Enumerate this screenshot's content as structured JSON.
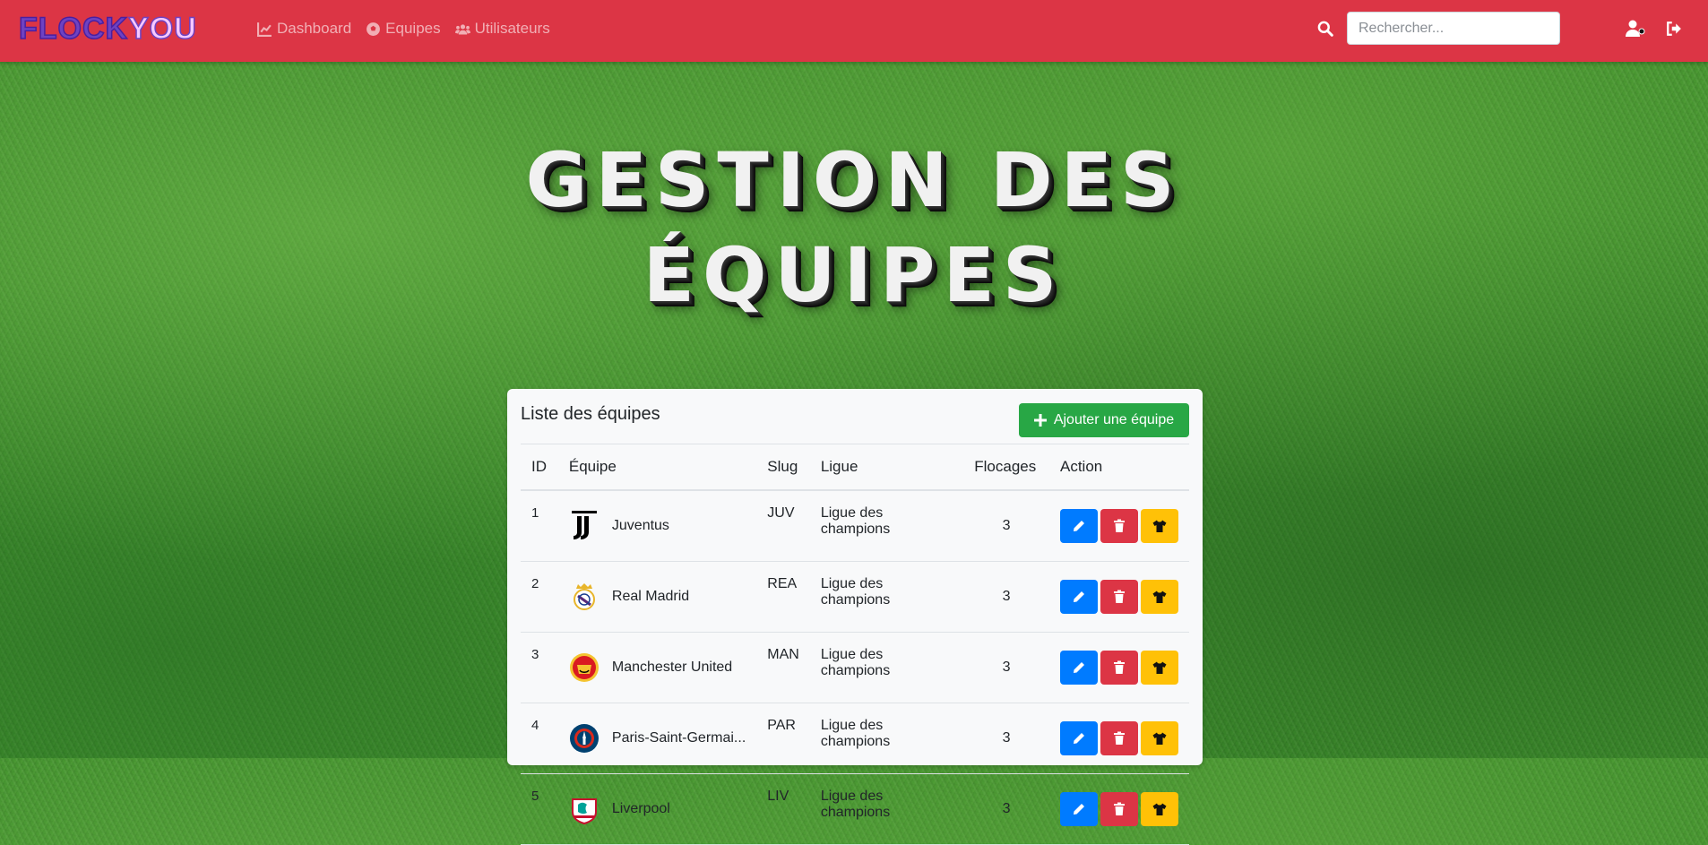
{
  "navbar": {
    "brand_part1": "FLOCK",
    "brand_part2": "YOU",
    "links": [
      {
        "label": "Dashboard",
        "icon": "chart-line-icon"
      },
      {
        "label": "Equipes",
        "icon": "football-icon"
      },
      {
        "label": "Utilisateurs",
        "icon": "users-icon"
      }
    ],
    "search_placeholder": "Rechercher..."
  },
  "hero": {
    "title_line1": "GESTION DES",
    "title_line2": "ÉQUIPES"
  },
  "card": {
    "title": "Liste des équipes",
    "add_button_label": "Ajouter une équipe",
    "columns": [
      "ID",
      "Équipe",
      "Slug",
      "Ligue",
      "Flocages",
      "Action"
    ],
    "rows": [
      {
        "id": "1",
        "team": "Juventus",
        "slug": "JUV",
        "league": "Ligue des champions",
        "flocages": "3",
        "logo": "juventus-logo"
      },
      {
        "id": "2",
        "team": "Real Madrid",
        "slug": "REA",
        "league": "Ligue des champions",
        "flocages": "3",
        "logo": "real-madrid-logo"
      },
      {
        "id": "3",
        "team": "Manchester United",
        "slug": "MAN",
        "league": "Ligue des champions",
        "flocages": "3",
        "logo": "manchester-united-logo"
      },
      {
        "id": "4",
        "team": "Paris-Saint-Germai...",
        "slug": "PAR",
        "league": "Ligue des champions",
        "flocages": "3",
        "logo": "psg-logo"
      },
      {
        "id": "5",
        "team": "Liverpool",
        "slug": "LIV",
        "league": "Ligue des champions",
        "flocages": "3",
        "logo": "liverpool-logo"
      }
    ]
  },
  "colors": {
    "navbar": "#dc3545",
    "edit": "#007bff",
    "delete": "#dc3545",
    "shirt": "#ffc107",
    "add": "#28a745"
  }
}
